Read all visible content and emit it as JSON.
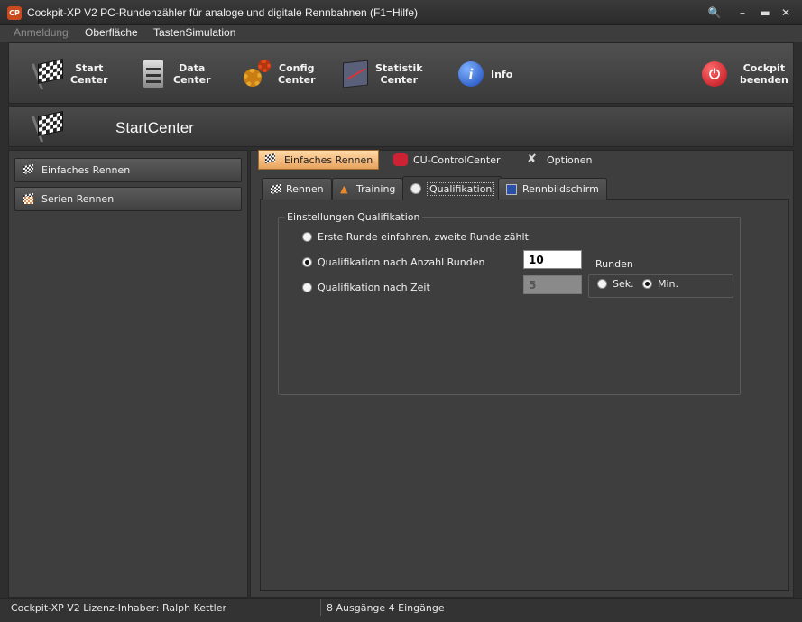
{
  "window": {
    "icon_text": "CP",
    "title": "Cockpit-XP V2 PC-Rundenzähler für analoge und digitale Rennbahnen (F1=Hilfe)"
  },
  "menu": [
    "Anmeldung",
    "Oberfläche",
    "TastenSimulation"
  ],
  "toolbar": {
    "buttons": [
      {
        "line1": "Start",
        "line2": "Center",
        "icon": "checkered-flag-icon"
      },
      {
        "line1": "Data",
        "line2": "Center",
        "icon": "server-icon"
      },
      {
        "line1": "Config",
        "line2": "Center",
        "icon": "gears-icon"
      },
      {
        "line1": "Statistik",
        "line2": "Center",
        "icon": "chart-icon"
      },
      {
        "line1": "Info",
        "line2": "",
        "icon": "info-icon"
      },
      {
        "line1": "Cockpit",
        "line2": "beenden",
        "icon": "power-icon"
      }
    ]
  },
  "header": {
    "title": "StartCenter"
  },
  "sidebar": {
    "items": [
      {
        "label": "Einfaches Rennen"
      },
      {
        "label": "Serien Rennen"
      }
    ]
  },
  "top_tabs": [
    {
      "label": "Einfaches Rennen",
      "active": true
    },
    {
      "label": "CU-ControlCenter",
      "active": false
    },
    {
      "label": "Optionen",
      "active": false
    }
  ],
  "inner_tabs": [
    {
      "label": "Rennen",
      "active": false
    },
    {
      "label": "Training",
      "active": false
    },
    {
      "label": "Qualifikation",
      "active": true
    },
    {
      "label": "Rennbildschirm",
      "active": false
    }
  ],
  "qualification": {
    "group_title": "Einstellungen Qualifikation",
    "options": [
      {
        "label": "Erste Runde einfahren, zweite Runde zählt",
        "selected": false
      },
      {
        "label": "Qualifikation nach Anzahl Runden",
        "selected": true
      },
      {
        "label": "Qualifikation nach Zeit",
        "selected": false
      }
    ],
    "laps_value": "10",
    "laps_unit": "Runden",
    "time_value": "5",
    "time_units": [
      {
        "label": "Sek.",
        "selected": false
      },
      {
        "label": "Min.",
        "selected": true
      }
    ]
  },
  "status": {
    "license": "Cockpit-XP V2 Lizenz-Inhaber: Ralph Kettler",
    "io": "8 Ausgänge 4 Eingänge"
  }
}
